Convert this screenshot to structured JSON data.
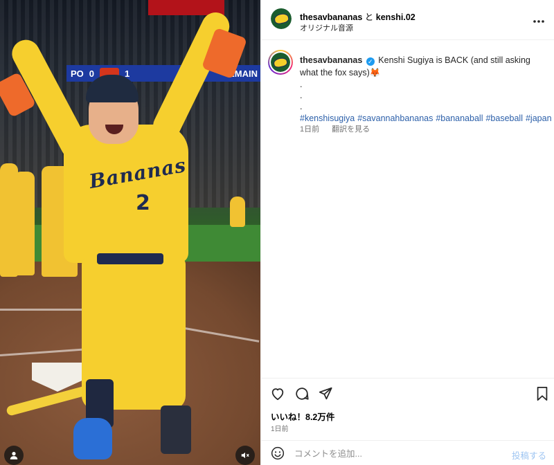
{
  "header": {
    "username": "thesavbananas",
    "joiner": " と ",
    "collaborator": "kenshi.02",
    "audio": "オリジナル音源",
    "more_icon": "more-horizontal-icon"
  },
  "caption": {
    "username": "thesavbananas",
    "text": "Kenshi Sugiya is BACK (and still asking what the fox says)🦊",
    "dots": [
      ".",
      ".",
      "."
    ],
    "hashtags": [
      "#kenshisugiya",
      "#savannahbananas",
      "#bananaball",
      "#baseball",
      "#japan"
    ],
    "time": "1日前",
    "translate": "翻訳を見る"
  },
  "media": {
    "scoreboard_text": "PO",
    "score_left": "0",
    "score_right": "1",
    "scoreboard_right": "EMAIN",
    "jersey_script": "Bananas",
    "jersey_number": "2"
  },
  "actions": {
    "likes": "いいね！8.2万件",
    "date": "1日前"
  },
  "comment": {
    "placeholder": "コメントを追加...",
    "post_label": "投稿する"
  },
  "colors": {
    "link": "#2b5fa9",
    "verified": "#1d9bf0",
    "post_button": "#9ec5f2",
    "jersey": "#f6cf2e"
  }
}
